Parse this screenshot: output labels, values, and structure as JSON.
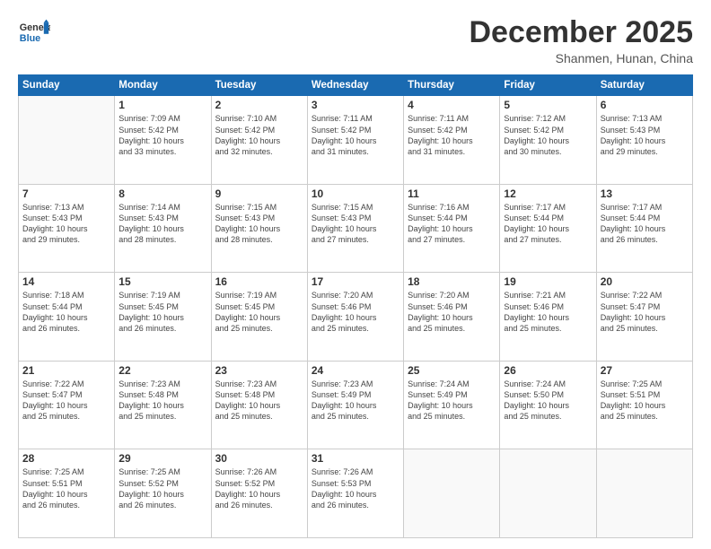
{
  "header": {
    "logo_general": "General",
    "logo_blue": "Blue",
    "month": "December 2025",
    "location": "Shanmen, Hunan, China"
  },
  "days_of_week": [
    "Sunday",
    "Monday",
    "Tuesday",
    "Wednesday",
    "Thursday",
    "Friday",
    "Saturday"
  ],
  "weeks": [
    [
      {
        "day": "",
        "text": ""
      },
      {
        "day": "1",
        "text": "Sunrise: 7:09 AM\nSunset: 5:42 PM\nDaylight: 10 hours\nand 33 minutes."
      },
      {
        "day": "2",
        "text": "Sunrise: 7:10 AM\nSunset: 5:42 PM\nDaylight: 10 hours\nand 32 minutes."
      },
      {
        "day": "3",
        "text": "Sunrise: 7:11 AM\nSunset: 5:42 PM\nDaylight: 10 hours\nand 31 minutes."
      },
      {
        "day": "4",
        "text": "Sunrise: 7:11 AM\nSunset: 5:42 PM\nDaylight: 10 hours\nand 31 minutes."
      },
      {
        "day": "5",
        "text": "Sunrise: 7:12 AM\nSunset: 5:42 PM\nDaylight: 10 hours\nand 30 minutes."
      },
      {
        "day": "6",
        "text": "Sunrise: 7:13 AM\nSunset: 5:43 PM\nDaylight: 10 hours\nand 29 minutes."
      }
    ],
    [
      {
        "day": "7",
        "text": "Sunrise: 7:13 AM\nSunset: 5:43 PM\nDaylight: 10 hours\nand 29 minutes."
      },
      {
        "day": "8",
        "text": "Sunrise: 7:14 AM\nSunset: 5:43 PM\nDaylight: 10 hours\nand 28 minutes."
      },
      {
        "day": "9",
        "text": "Sunrise: 7:15 AM\nSunset: 5:43 PM\nDaylight: 10 hours\nand 28 minutes."
      },
      {
        "day": "10",
        "text": "Sunrise: 7:15 AM\nSunset: 5:43 PM\nDaylight: 10 hours\nand 27 minutes."
      },
      {
        "day": "11",
        "text": "Sunrise: 7:16 AM\nSunset: 5:44 PM\nDaylight: 10 hours\nand 27 minutes."
      },
      {
        "day": "12",
        "text": "Sunrise: 7:17 AM\nSunset: 5:44 PM\nDaylight: 10 hours\nand 27 minutes."
      },
      {
        "day": "13",
        "text": "Sunrise: 7:17 AM\nSunset: 5:44 PM\nDaylight: 10 hours\nand 26 minutes."
      }
    ],
    [
      {
        "day": "14",
        "text": "Sunrise: 7:18 AM\nSunset: 5:44 PM\nDaylight: 10 hours\nand 26 minutes."
      },
      {
        "day": "15",
        "text": "Sunrise: 7:19 AM\nSunset: 5:45 PM\nDaylight: 10 hours\nand 26 minutes."
      },
      {
        "day": "16",
        "text": "Sunrise: 7:19 AM\nSunset: 5:45 PM\nDaylight: 10 hours\nand 25 minutes."
      },
      {
        "day": "17",
        "text": "Sunrise: 7:20 AM\nSunset: 5:46 PM\nDaylight: 10 hours\nand 25 minutes."
      },
      {
        "day": "18",
        "text": "Sunrise: 7:20 AM\nSunset: 5:46 PM\nDaylight: 10 hours\nand 25 minutes."
      },
      {
        "day": "19",
        "text": "Sunrise: 7:21 AM\nSunset: 5:46 PM\nDaylight: 10 hours\nand 25 minutes."
      },
      {
        "day": "20",
        "text": "Sunrise: 7:22 AM\nSunset: 5:47 PM\nDaylight: 10 hours\nand 25 minutes."
      }
    ],
    [
      {
        "day": "21",
        "text": "Sunrise: 7:22 AM\nSunset: 5:47 PM\nDaylight: 10 hours\nand 25 minutes."
      },
      {
        "day": "22",
        "text": "Sunrise: 7:23 AM\nSunset: 5:48 PM\nDaylight: 10 hours\nand 25 minutes."
      },
      {
        "day": "23",
        "text": "Sunrise: 7:23 AM\nSunset: 5:48 PM\nDaylight: 10 hours\nand 25 minutes."
      },
      {
        "day": "24",
        "text": "Sunrise: 7:23 AM\nSunset: 5:49 PM\nDaylight: 10 hours\nand 25 minutes."
      },
      {
        "day": "25",
        "text": "Sunrise: 7:24 AM\nSunset: 5:49 PM\nDaylight: 10 hours\nand 25 minutes."
      },
      {
        "day": "26",
        "text": "Sunrise: 7:24 AM\nSunset: 5:50 PM\nDaylight: 10 hours\nand 25 minutes."
      },
      {
        "day": "27",
        "text": "Sunrise: 7:25 AM\nSunset: 5:51 PM\nDaylight: 10 hours\nand 25 minutes."
      }
    ],
    [
      {
        "day": "28",
        "text": "Sunrise: 7:25 AM\nSunset: 5:51 PM\nDaylight: 10 hours\nand 26 minutes."
      },
      {
        "day": "29",
        "text": "Sunrise: 7:25 AM\nSunset: 5:52 PM\nDaylight: 10 hours\nand 26 minutes."
      },
      {
        "day": "30",
        "text": "Sunrise: 7:26 AM\nSunset: 5:52 PM\nDaylight: 10 hours\nand 26 minutes."
      },
      {
        "day": "31",
        "text": "Sunrise: 7:26 AM\nSunset: 5:53 PM\nDaylight: 10 hours\nand 26 minutes."
      },
      {
        "day": "",
        "text": ""
      },
      {
        "day": "",
        "text": ""
      },
      {
        "day": "",
        "text": ""
      }
    ]
  ]
}
